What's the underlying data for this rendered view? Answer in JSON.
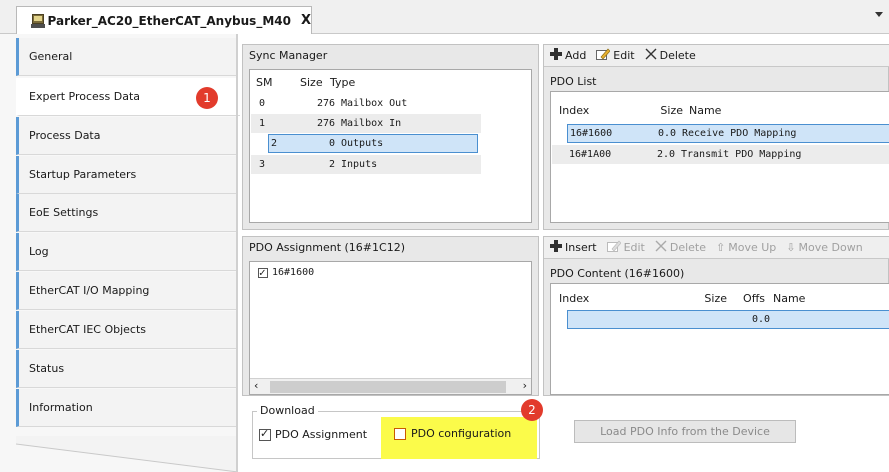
{
  "tab": {
    "title": "Parker_AC20_EtherCAT_Anybus_M40",
    "close": "X"
  },
  "nav": {
    "items": [
      {
        "label": "General"
      },
      {
        "label": "Expert Process Data"
      },
      {
        "label": "Process Data"
      },
      {
        "label": "Startup Parameters"
      },
      {
        "label": "EoE Settings"
      },
      {
        "label": "Log"
      },
      {
        "label": "EtherCAT I/O Mapping"
      },
      {
        "label": "EtherCAT IEC Objects"
      },
      {
        "label": "Status"
      },
      {
        "label": "Information"
      }
    ],
    "active_index": 1
  },
  "badges": {
    "one": "1",
    "two": "2"
  },
  "sync_manager": {
    "title": "Sync Manager",
    "headers": {
      "sm": "SM",
      "size": "Size",
      "type": "Type"
    },
    "rows": [
      {
        "sm": "0",
        "size": "276",
        "type": "Mailbox Out"
      },
      {
        "sm": "1",
        "size": "276",
        "type": "Mailbox In"
      },
      {
        "sm": "2",
        "size": "0",
        "type": "Outputs"
      },
      {
        "sm": "3",
        "size": "2",
        "type": "Inputs"
      }
    ]
  },
  "pdo_list": {
    "toolbar": {
      "add": "Add",
      "edit": "Edit",
      "delete": "Delete"
    },
    "title": "PDO List",
    "headers": {
      "index": "Index",
      "size": "Size",
      "name": "Name"
    },
    "rows": [
      {
        "index": "16#1600",
        "size": "0.0",
        "name": "Receive PDO Mapping"
      },
      {
        "index": "16#1A00",
        "size": "2.0",
        "name": "Transmit PDO Mapping"
      }
    ]
  },
  "pdo_assignment": {
    "title": "PDO Assignment (16#1C12)",
    "items": [
      {
        "label": "16#1600",
        "checked": true
      }
    ]
  },
  "pdo_content": {
    "toolbar": {
      "insert": "Insert",
      "edit": "Edit",
      "delete": "Delete",
      "move_up": "Move Up",
      "move_down": "Move Down"
    },
    "title": "PDO Content (16#1600)",
    "headers": {
      "index": "Index",
      "size": "Size",
      "offs": "Offs",
      "name": "Name"
    },
    "rows": [
      {
        "offs": "0.0"
      }
    ]
  },
  "download": {
    "legend": "Download",
    "pdo_assignment_label": "PDO Assignment",
    "pdo_assignment_checked": true,
    "pdo_configuration_label": "PDO configuration",
    "pdo_configuration_checked": false
  },
  "load_button": "Load PDO Info from the Device",
  "colors": {
    "accent": "#5c9bd6",
    "badge": "#e23b2c",
    "highlight": "#fbfb4a",
    "selection": "#cfe4f8"
  }
}
